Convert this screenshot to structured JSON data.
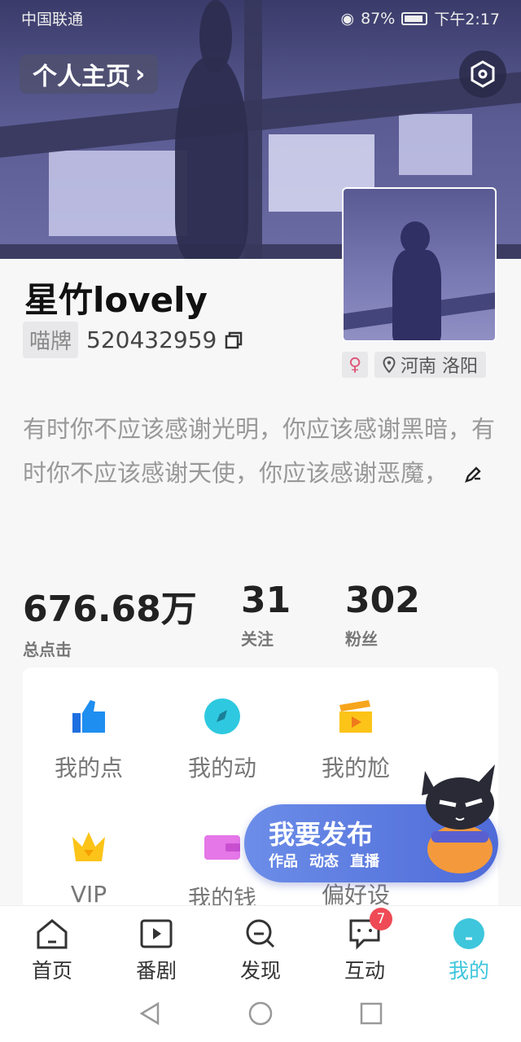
{
  "status": {
    "carrier": "中国联通",
    "battery": "87%",
    "time": "下午2:17"
  },
  "header": {
    "homepage_label": "个人主页"
  },
  "profile": {
    "username": "星竹lovely",
    "id_tag": "喵牌",
    "id_number": "520432959",
    "gender": "♀",
    "location": "河南 洛阳",
    "bio": "有时你不应该感谢光明，你应该感谢黑暗，有时你不应该感谢天使，你应该感谢恶魔，"
  },
  "stats": [
    {
      "value": "676.68万",
      "label": "总点击"
    },
    {
      "value": "31",
      "label": "关注"
    },
    {
      "value": "302",
      "label": "粉丝"
    }
  ],
  "grid": [
    {
      "label": "我的点",
      "icon": "thumbs-up-icon"
    },
    {
      "label": "我的动",
      "icon": "compass-icon"
    },
    {
      "label": "我的尬",
      "icon": "clapperboard-icon"
    },
    {
      "label": "VIP",
      "icon": "crown-icon"
    },
    {
      "label": "我的钱",
      "icon": "wallet-icon"
    },
    {
      "label": "偏好设",
      "icon": "settings-icon"
    }
  ],
  "publish": {
    "title": "我要发布",
    "subs": [
      "作品",
      "动态",
      "直播"
    ]
  },
  "nav": [
    {
      "label": "首页",
      "icon": "home-icon"
    },
    {
      "label": "番剧",
      "icon": "play-icon"
    },
    {
      "label": "发现",
      "icon": "discover-icon"
    },
    {
      "label": "互动",
      "icon": "message-icon",
      "badge": "7"
    },
    {
      "label": "我的",
      "icon": "profile-icon",
      "active": true
    }
  ],
  "colors": {
    "accent": "#3ec6dc",
    "publish": "#5a78e0",
    "badge": "#ef4b56"
  }
}
